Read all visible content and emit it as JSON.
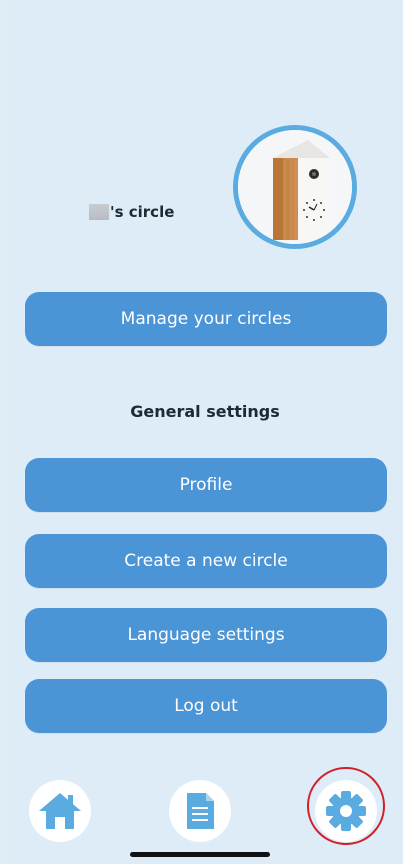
{
  "circle": {
    "name_suffix": "'s circle"
  },
  "buttons": {
    "manage_circles": "Manage your circles",
    "profile": "Profile",
    "create_circle": "Create a new circle",
    "language": "Language settings",
    "logout": "Log out"
  },
  "sections": {
    "general_settings": "General settings"
  },
  "nav": {
    "items": [
      {
        "icon": "home-icon",
        "active": false
      },
      {
        "icon": "document-icon",
        "active": false
      },
      {
        "icon": "gear-icon",
        "active": true
      }
    ]
  },
  "colors": {
    "background": "#ddecf6",
    "button": "#4b94d6",
    "icon": "#5aabe0",
    "highlight": "#d21f2a"
  }
}
